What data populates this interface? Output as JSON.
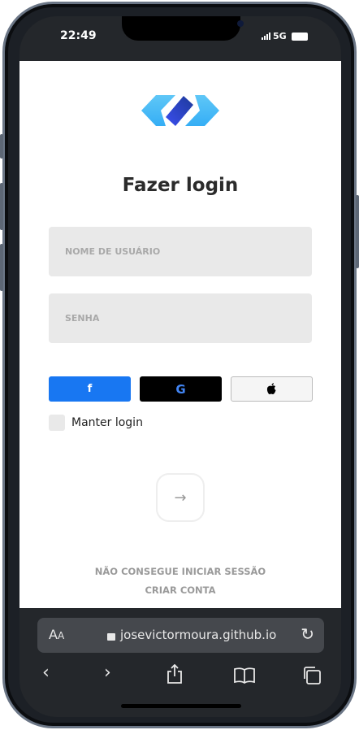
{
  "status": {
    "time": "22:49",
    "network": "5G"
  },
  "page": {
    "title": "Fazer login",
    "username_placeholder": "NOME DE USUÁRIO",
    "password_placeholder": "SENHA",
    "keep_login": "Manter login",
    "forgot": "NÃO CONSEGUE INICIAR SESSÃO",
    "create": "CRIAR CONTA",
    "submit_icon": "arrow-right-icon"
  },
  "social": [
    {
      "name": "facebook",
      "label": "f",
      "color": "#1877f2"
    },
    {
      "name": "google",
      "label": "G",
      "color": "#000000"
    },
    {
      "name": "apple",
      "label": "",
      "color": "#f5f5f5"
    }
  ],
  "browser": {
    "aa": "A",
    "aa_small": "A",
    "url": "josevictormoura.github.io"
  }
}
